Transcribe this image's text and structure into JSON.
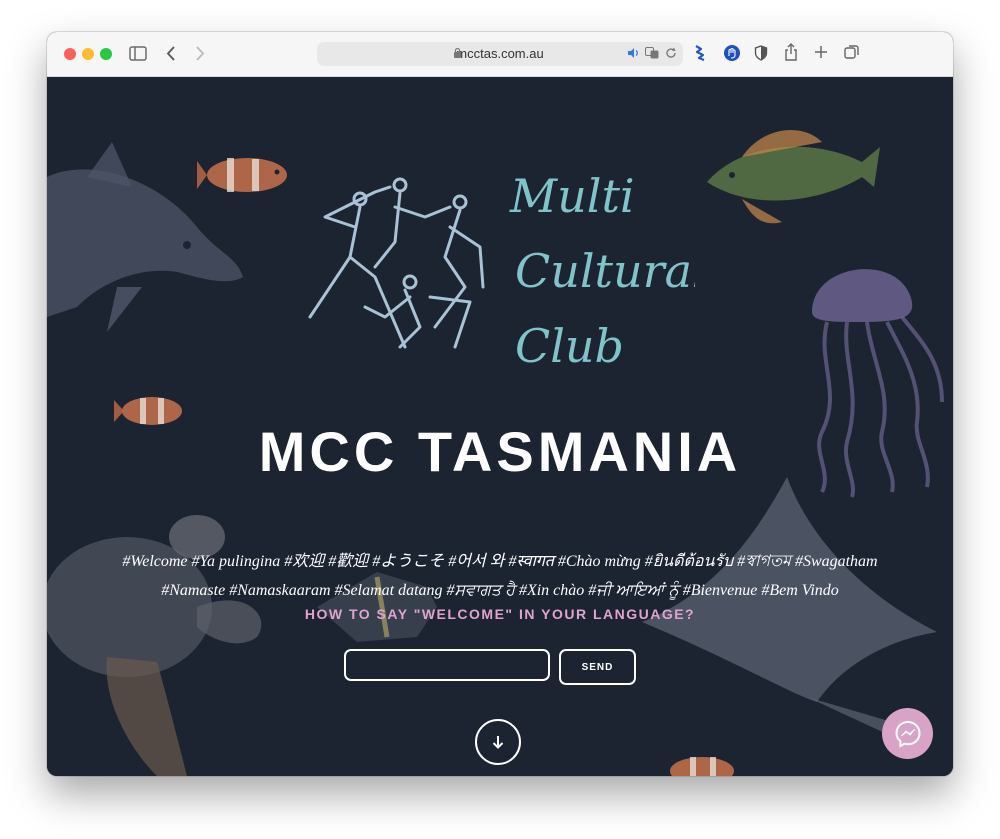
{
  "browser": {
    "url": "mcctas.com.au",
    "traffic_lights": [
      "#ff5f57",
      "#febc2e",
      "#28c840"
    ]
  },
  "logo": {
    "text_lines": [
      "Multi",
      "Cultural",
      "Club"
    ],
    "color": "#7fc4c9"
  },
  "hero": {
    "title": "MCC TASMANIA",
    "greetings_line1": "#Welcome #Ya pulingina #欢迎 #歡迎 #ようこそ #어서 와 #स्वागत #Chào mừng #ยินดีต้อนรับ #স্বাগতম #Swagatham",
    "greetings_line2": "#Namaste #Namaskaaram #Selamat datang #ਸਵਾਗਤ ਹੈ #Xin chào #ਜੀ ਆਇਆਂ ਨੂੰ #Bienvenue #Bem Vindo"
  },
  "form": {
    "question": "HOW TO SAY \"WELCOME\" IN YOUR LANGUAGE?",
    "input_value": "",
    "send_label": "SEND"
  },
  "colors": {
    "background": "#1c2431",
    "accent_pink": "#e0a3cf",
    "messenger": "#d8a3c6"
  },
  "icons": {
    "scroll_down": "arrow-down-icon",
    "chat": "messenger-icon"
  }
}
